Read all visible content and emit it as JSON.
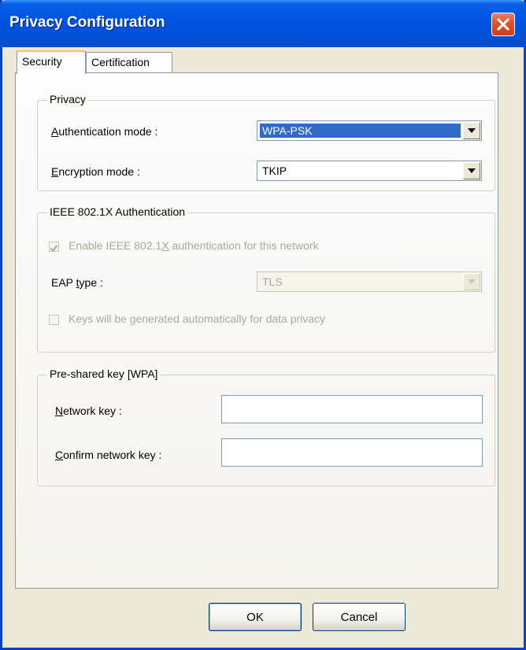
{
  "window": {
    "title": "Privacy Configuration"
  },
  "tabs": [
    {
      "label": "Security",
      "active": true
    },
    {
      "label": "Certification",
      "active": false
    }
  ],
  "privacy": {
    "legend": "Privacy",
    "auth_mode_label_u": "A",
    "auth_mode_label_rest": "uthentication mode :",
    "auth_mode_value": "WPA-PSK",
    "enc_mode_label_u": "E",
    "enc_mode_label_rest": "ncryption mode :",
    "enc_mode_value": "TKIP"
  },
  "ieee": {
    "legend": "IEEE 802.1X Authentication",
    "enable_label_pre": "Enable IEEE 802.1",
    "enable_label_u": "X",
    "enable_label_post": " authentication for this network",
    "enable_checked": true,
    "eap_label_pre": "EAP ",
    "eap_label_u": "t",
    "eap_label_post": "ype :",
    "eap_value": "TLS",
    "keys_label": "Keys will be generated automatically for data privacy",
    "keys_checked": false
  },
  "psk": {
    "legend": "Pre-shared key [WPA]",
    "network_key_label_u": "N",
    "network_key_label_rest": "etwork key :",
    "network_key_value": "",
    "confirm_key_label_u": "C",
    "confirm_key_label_rest": "onfirm network key :",
    "confirm_key_value": ""
  },
  "buttons": {
    "ok": "OK",
    "cancel": "Cancel"
  }
}
